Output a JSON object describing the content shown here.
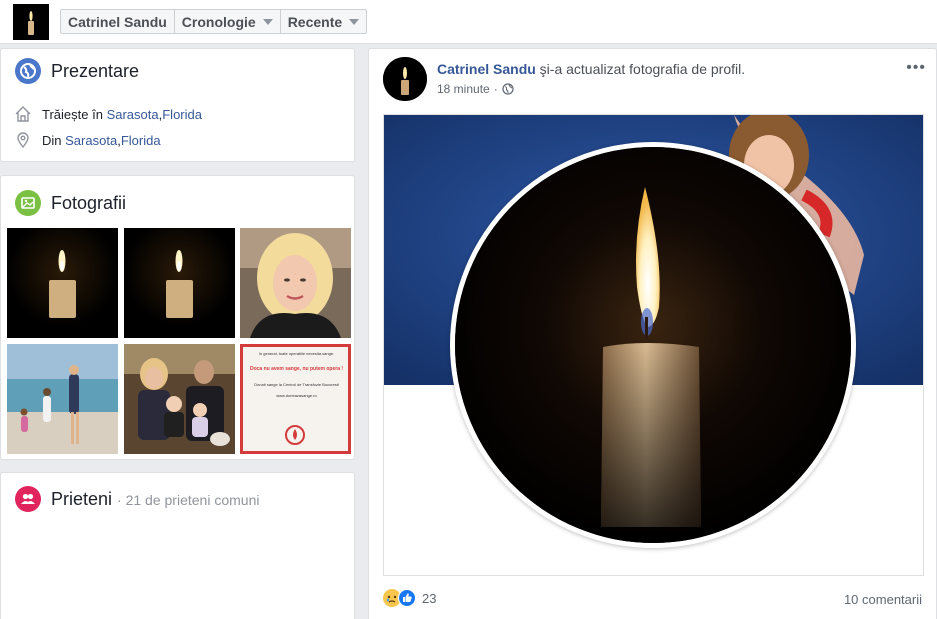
{
  "topbar": {
    "nav": [
      {
        "label": "Catrinel Sandu",
        "dropdown": false
      },
      {
        "label": "Cronologie",
        "dropdown": true
      },
      {
        "label": "Recente",
        "dropdown": true
      }
    ]
  },
  "intro": {
    "title": "Prezentare",
    "lives_prefix": "Trăiește în",
    "lives_city": "Sarasota",
    "lives_sep": ", ",
    "lives_state": "Florida",
    "from_prefix": "Din",
    "from_city": "Sarasota",
    "from_sep": ", ",
    "from_state": "Florida"
  },
  "photos": {
    "title": "Fotografii",
    "flyer_line1": "In general, toate operatiile necesita sange.",
    "flyer_line2": "Doca nu avem sange, nu putem opera !",
    "flyer_line3": "Donati sange la Centrul de Transfuzie Bucuresti",
    "flyer_line4": "www.doneazasange.ro"
  },
  "friends": {
    "title": "Prieteni",
    "mutual": "· 21 de prieteni comuni"
  },
  "post": {
    "author": "Catrinel Sandu",
    "action": " şi-a actualizat fotografia de profil.",
    "time": "18 minute",
    "more": "•••",
    "reaction_count": "23",
    "comments": "10 comentarii"
  },
  "colors": {
    "link": "#365899",
    "intro_icon": "#4a77c9",
    "photos_icon": "#7ac143",
    "friends_icon": "#e0245e",
    "like_blue": "#1877f2",
    "sad_yellow": "#f7c64c"
  }
}
